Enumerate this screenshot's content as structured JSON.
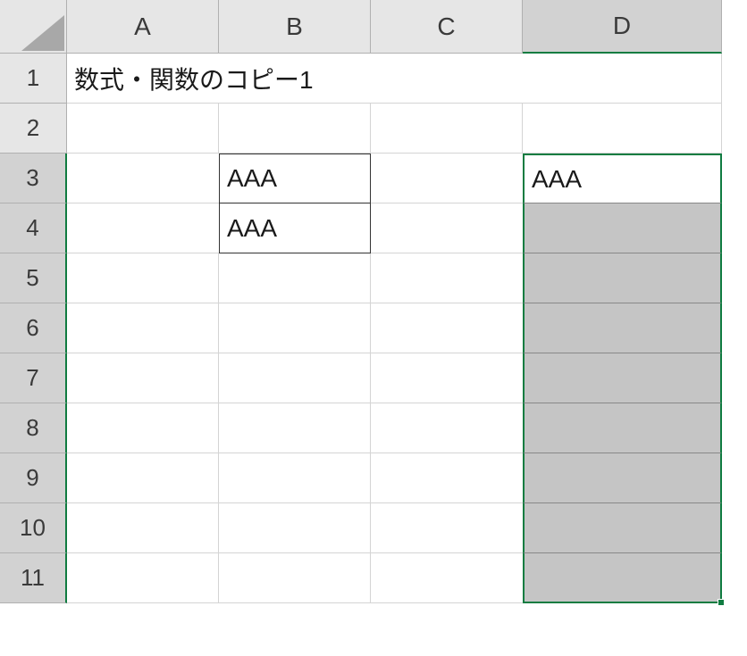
{
  "columns": [
    "A",
    "B",
    "C",
    "D"
  ],
  "rows": [
    "1",
    "2",
    "3",
    "4",
    "5",
    "6",
    "7",
    "8",
    "9",
    "10",
    "11"
  ],
  "selectedColumn": "D",
  "selectedRowsStart": 3,
  "selectedRowsEnd": 11,
  "activeCell": "D3",
  "cells": {
    "A1": "数式・関数のコピー1",
    "B3": "AAA",
    "B4": "AAA",
    "D3": "AAA"
  },
  "boxedRange": [
    "B3",
    "B4"
  ],
  "colors": {
    "headerBg": "#e6e6e6",
    "headerSelectedBg": "#d2d2d2",
    "selectionBorder": "#107c41",
    "selectionFill": "#c5c5c5"
  }
}
